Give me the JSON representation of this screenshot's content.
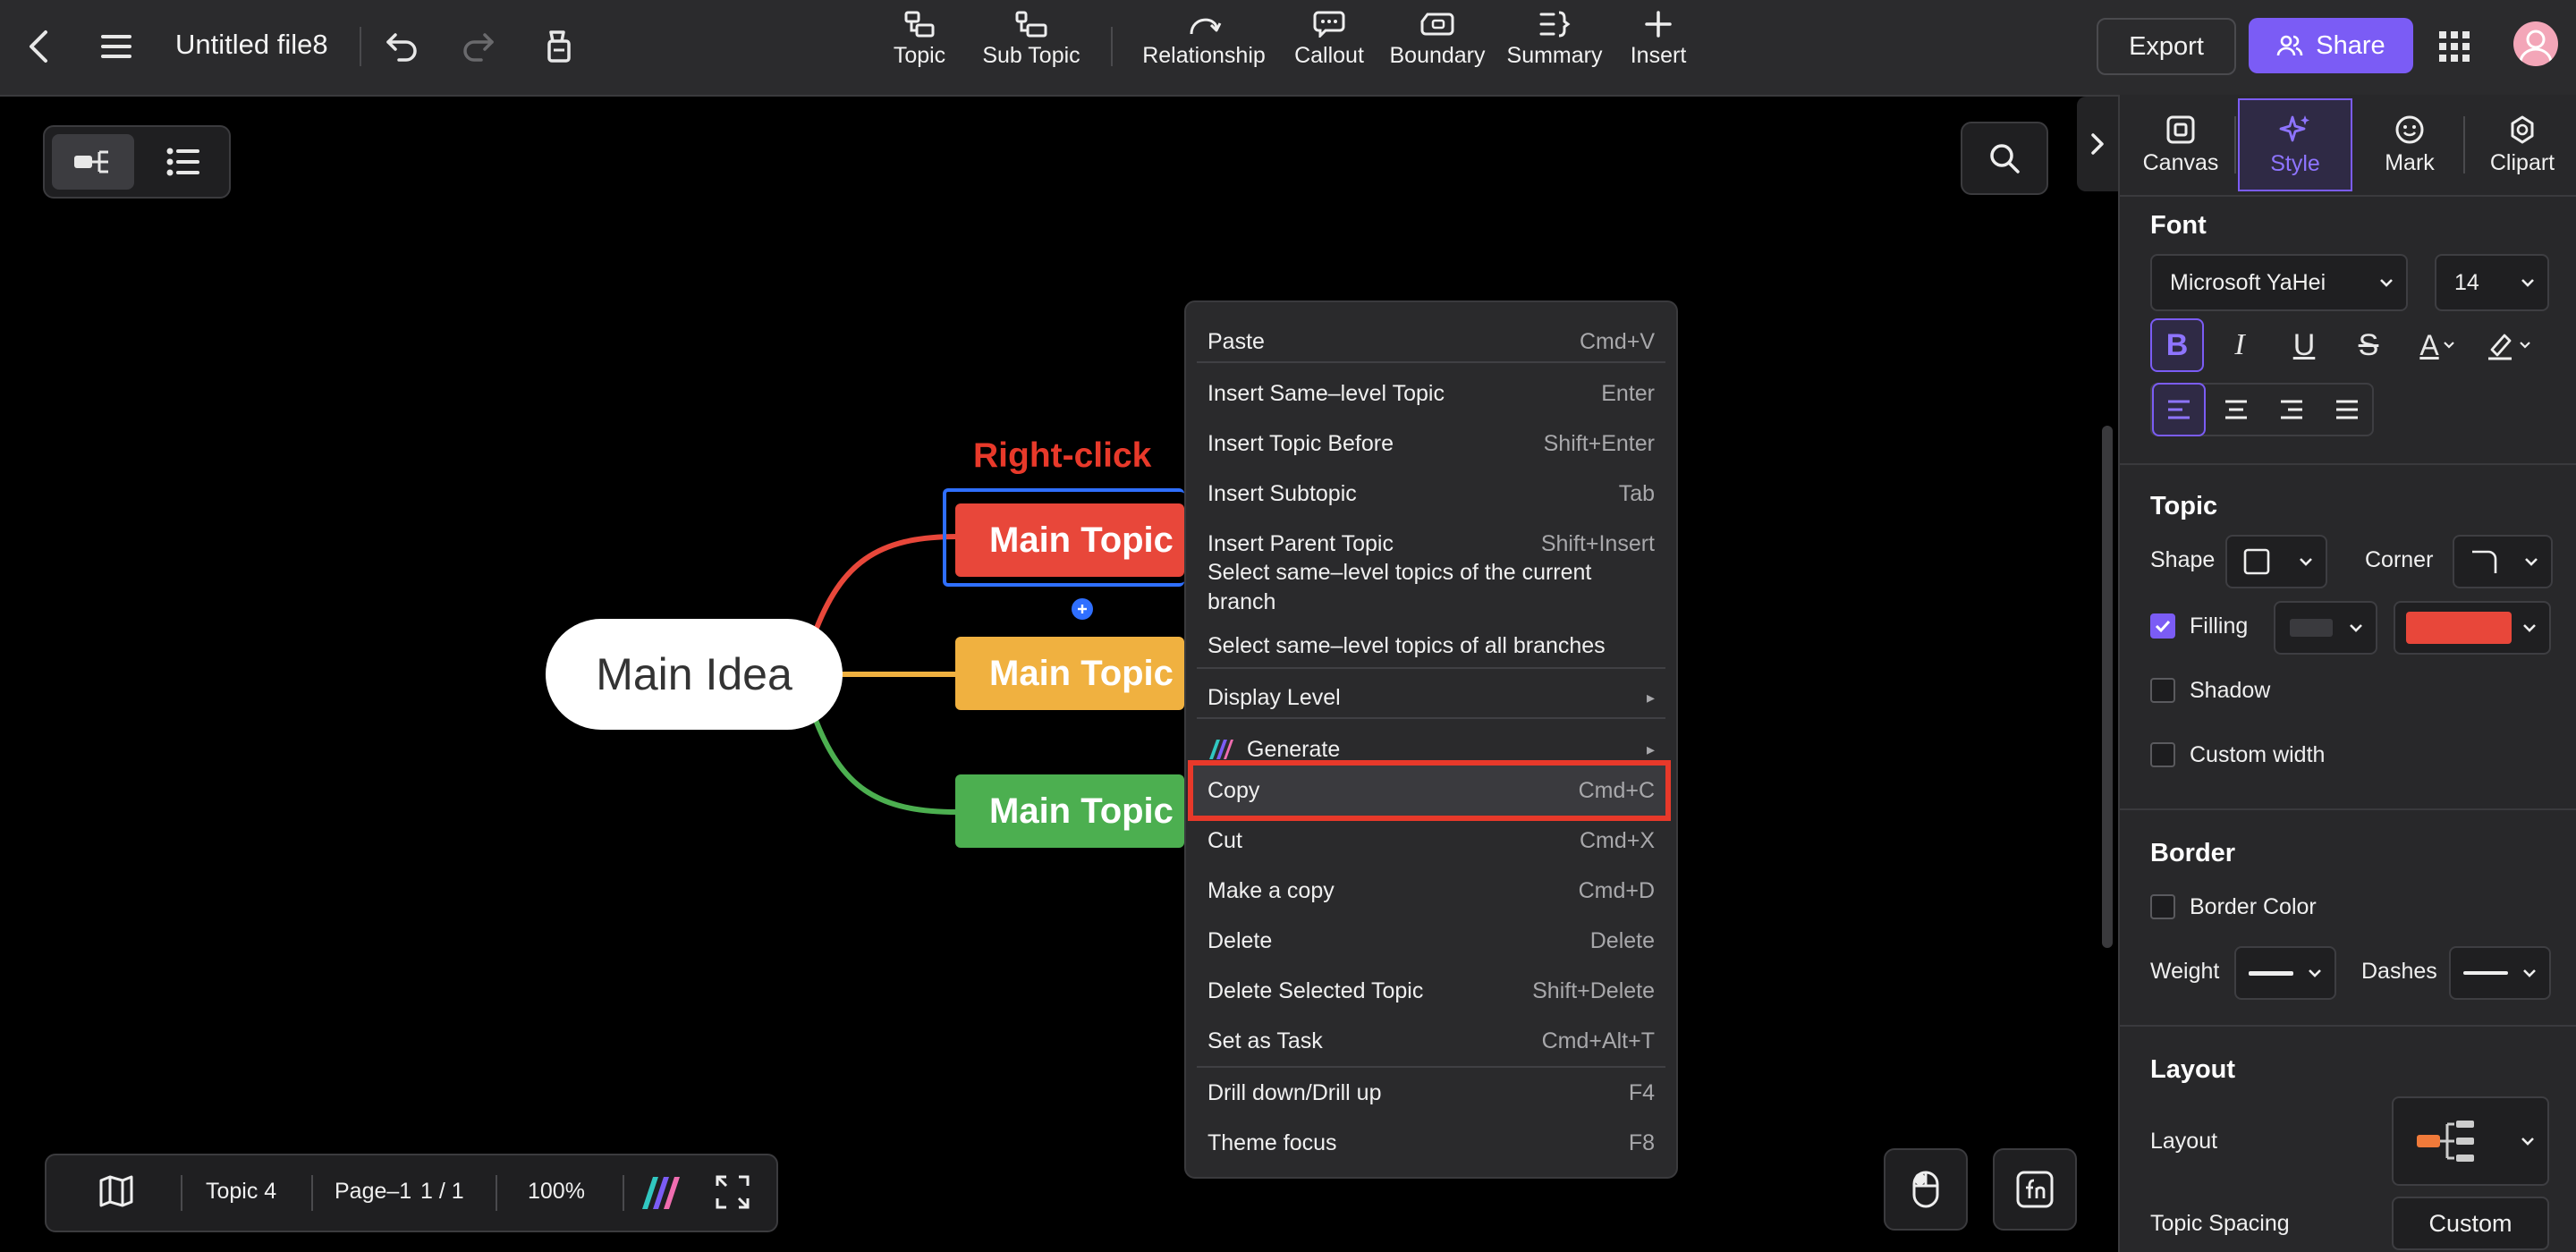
{
  "app": {
    "file_title": "Untitled file8",
    "export_label": "Export",
    "share_label": "Share"
  },
  "toolbar": {
    "items": [
      {
        "label": "Topic",
        "icon": "topic-icon"
      },
      {
        "label": "Sub Topic",
        "icon": "subtopic-icon"
      },
      {
        "label": "Relationship",
        "icon": "relationship-icon"
      },
      {
        "label": "Callout",
        "icon": "callout-icon"
      },
      {
        "label": "Boundary",
        "icon": "boundary-icon"
      },
      {
        "label": "Summary",
        "icon": "summary-icon"
      },
      {
        "label": "Insert",
        "icon": "plus-icon"
      }
    ]
  },
  "canvas": {
    "annotation": "Right-click",
    "main_idea": "Main Idea",
    "topics": [
      "Main Topic",
      "Main Topic",
      "Main Topic"
    ],
    "colors": {
      "topic1": "#e8473a",
      "topic2": "#f0b140",
      "topic3": "#4caf50",
      "selection": "#2f6fff"
    }
  },
  "context_menu": {
    "items": [
      {
        "label": "Paste",
        "shortcut": "Cmd+V"
      },
      {
        "label": "Insert Same–level Topic",
        "shortcut": "Enter"
      },
      {
        "label": "Insert Topic Before",
        "shortcut": "Shift+Enter"
      },
      {
        "label": "Insert Subtopic",
        "shortcut": "Tab"
      },
      {
        "label": "Insert Parent Topic",
        "shortcut": "Shift+Insert"
      },
      {
        "label": "Select same–level topics of the current branch",
        "shortcut": ""
      },
      {
        "label": "Select same–level topics of all branches",
        "shortcut": ""
      },
      {
        "label": "Display Level",
        "shortcut": "▸"
      },
      {
        "label": "Generate",
        "shortcut": "▸"
      },
      {
        "label": "Copy",
        "shortcut": "Cmd+C"
      },
      {
        "label": "Cut",
        "shortcut": "Cmd+X"
      },
      {
        "label": "Make a copy",
        "shortcut": "Cmd+D"
      },
      {
        "label": "Delete",
        "shortcut": "Delete"
      },
      {
        "label": "Delete Selected Topic",
        "shortcut": "Shift+Delete"
      },
      {
        "label": "Set as Task",
        "shortcut": "Cmd+Alt+T"
      },
      {
        "label": "Drill down/Drill up",
        "shortcut": "F4"
      },
      {
        "label": "Theme focus",
        "shortcut": "F8"
      }
    ],
    "highlight_color": "#e8392a"
  },
  "panel": {
    "tabs": [
      "Canvas",
      "Style",
      "Mark",
      "Clipart"
    ],
    "active_tab": "Style",
    "accent": "#7b5cf5",
    "font": {
      "title": "Font",
      "family": "Microsoft YaHei",
      "size": "14",
      "bold": "B",
      "italic": "I",
      "underline": "U",
      "strike": "S",
      "color_glyph": "A"
    },
    "topic": {
      "title": "Topic",
      "shape_label": "Shape",
      "corner_label": "Corner",
      "filling_label": "Filling",
      "filling_checked": true,
      "fill_color": "#e8473a",
      "shadow_label": "Shadow",
      "custom_width_label": "Custom width"
    },
    "border": {
      "title": "Border",
      "color_label": "Border Color",
      "weight_label": "Weight",
      "dashes_label": "Dashes"
    },
    "layout": {
      "title": "Layout",
      "layout_label": "Layout",
      "spacing_label": "Topic Spacing",
      "spacing_value": "Custom"
    }
  },
  "bottom_bar": {
    "topic_count": "Topic 4",
    "page_label": "Page–1",
    "page_count": "1 / 1",
    "zoom": "100%"
  }
}
